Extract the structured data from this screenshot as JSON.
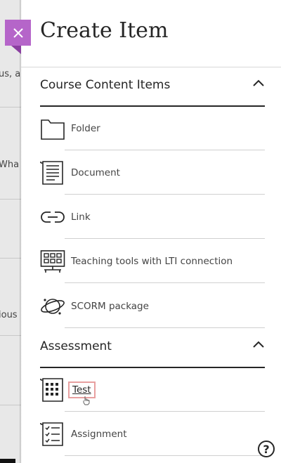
{
  "background": {
    "snippets": [
      "us, a",
      "Wha",
      "ious"
    ]
  },
  "panel": {
    "title": "Create Item",
    "close_icon": "close-icon",
    "accent_color": "#b565c9"
  },
  "sections": [
    {
      "title": "Course Content Items",
      "items": [
        {
          "label": "Folder",
          "icon": "folder-icon"
        },
        {
          "label": "Document",
          "icon": "document-icon"
        },
        {
          "label": "Link",
          "icon": "link-icon"
        },
        {
          "label": "Teaching tools with LTI connection",
          "icon": "lti-tools-icon"
        },
        {
          "label": "SCORM package",
          "icon": "scorm-package-icon"
        }
      ]
    },
    {
      "title": "Assessment",
      "items": [
        {
          "label": "Test",
          "icon": "test-icon"
        },
        {
          "label": "Assignment",
          "icon": "assignment-icon"
        }
      ]
    }
  ],
  "help": {
    "label": "?"
  }
}
